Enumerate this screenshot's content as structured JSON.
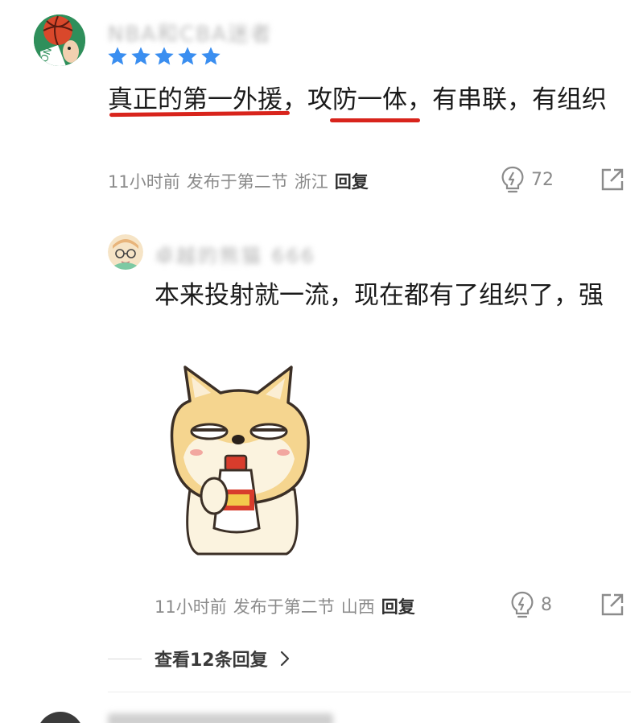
{
  "comment": {
    "username": "NBA和CBA迷者",
    "rating_stars": 5,
    "text_parts": [
      "真正的第一外援",
      "，",
      "攻防一体",
      "，有串联，有组织"
    ],
    "time": "11小时前",
    "section": "发布于第二节",
    "location": "浙江",
    "reply_label": "回复",
    "likes": "72",
    "like_icon": "lightbulb-icon",
    "share_icon": "share-external-icon",
    "accent_color": "#d8241c",
    "star_color": "#3a8ef0"
  },
  "reply": {
    "username": "卓越的熊猫 666",
    "text": "本来投射就一流，现在都有了组织了，强",
    "sticker_icon": "shiba-dog-drinking-sticker",
    "time": "11小时前",
    "section": "发布于第二节",
    "location": "山西",
    "reply_label": "回复",
    "likes": "8"
  },
  "view_replies": {
    "label": "查看12条回复",
    "chevron_icon": "chevron-right-icon"
  }
}
